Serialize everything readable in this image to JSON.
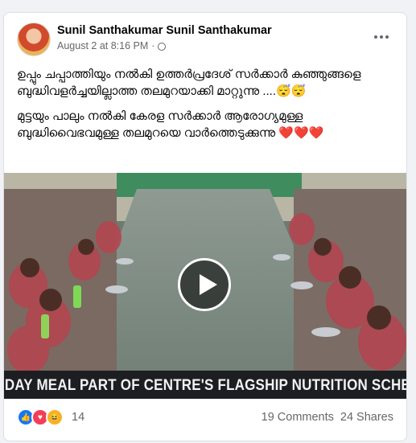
{
  "post": {
    "author": "Sunil Santhakumar Sunil Santhakumar",
    "timestamp": "August 2 at 8:16 PM",
    "separator": "·",
    "paragraph_1": "ഉപ്പും ചപ്പാത്തിയും നൽകി ഉത്തർപ്രദേശ് സർക്കാർ കുഞ്ഞുങ്ങളെ ബുദ്ധിവളർച്ചയില്ലാത്ത തലമുറയാക്കി മാറ്റുന്നു ....😴😴",
    "paragraph_2": "മുട്ടയും പാലും നൽകി കേരള സർക്കാർ ആരോഗ്യമുള്ള ബുദ്ധിവൈഭവമുള്ള തലമുറയെ വാർത്തെടുക്കുന്നു ❤️❤️❤️"
  },
  "video": {
    "ticker": "MIDDAY MEAL PART OF CENTRE'S FLAGSHIP NUTRITION SCHEME"
  },
  "stats": {
    "reaction_count": "14",
    "comments": "19 Comments",
    "shares": "24 Shares"
  },
  "icons": {
    "like": "👍",
    "love": "♥",
    "haha": "😆"
  },
  "colors": {
    "like": "#1877f2",
    "love": "#f33e58",
    "haha": "#f7b125",
    "ticker_bg": "#1c1e21"
  }
}
